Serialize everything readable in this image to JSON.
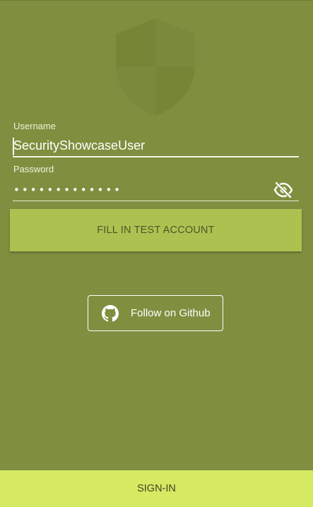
{
  "colors": {
    "background": "#7f8f3f",
    "fill_button": "#abc251",
    "signin_bar": "#d5e963",
    "text_light": "#ffffff"
  },
  "logo": {
    "icon": "shield-icon"
  },
  "username": {
    "label": "Username",
    "value": "SecurityShowcaseUser"
  },
  "password": {
    "label": "Password",
    "value": "•••••••••••••",
    "toggle_icon": "eye-off-icon"
  },
  "fill_test_account": {
    "label": "FILL IN TEST ACCOUNT"
  },
  "github": {
    "label": "Follow on Github",
    "icon": "github-icon"
  },
  "signin": {
    "label": "SIGN-IN"
  }
}
